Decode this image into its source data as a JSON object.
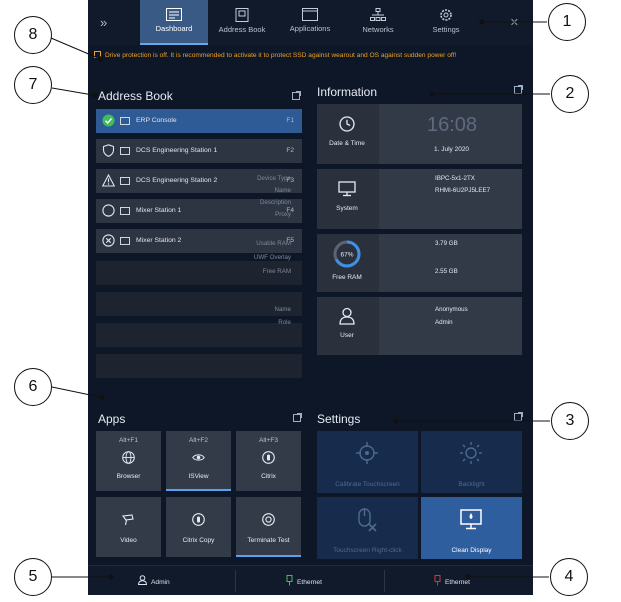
{
  "nav": {
    "tabs": [
      {
        "label": "Dashboard",
        "icon": "dashboard-icon",
        "active": true
      },
      {
        "label": "Address Book",
        "icon": "address-book-icon",
        "active": false
      },
      {
        "label": "Applications",
        "icon": "applications-icon",
        "active": false
      },
      {
        "label": "Networks",
        "icon": "networks-icon",
        "active": false
      },
      {
        "label": "Settings",
        "icon": "gear-icon",
        "active": false
      }
    ],
    "expand_glyph": "»",
    "close_glyph": "✕"
  },
  "warning": {
    "text": "Drive protection is off. It is recommended to activate it to protect SSD against wearout and OS against sudden power off!"
  },
  "address_book": {
    "title": "Address Book",
    "entries": [
      {
        "label": "ERP Console",
        "key": "F1",
        "status": "check-circle-icon",
        "selected": true
      },
      {
        "label": "DCS Engineering Station 1",
        "key": "F2",
        "status": "shield-icon",
        "selected": false
      },
      {
        "label": "DCS Engineering Station 2",
        "key": "F3",
        "status": "warning-triangle-icon",
        "selected": false
      },
      {
        "label": "Mixer Station 1",
        "key": "F4",
        "status": "empty-circle-icon",
        "selected": false
      },
      {
        "label": "Mixer Station 2",
        "key": "F5",
        "status": "x-circle-icon",
        "selected": false
      }
    ]
  },
  "information": {
    "title": "Information",
    "date_time": {
      "label": "Date & Time",
      "time": "16:08",
      "date": "1. July 2020"
    },
    "system": {
      "label": "System",
      "fields": [
        {
          "k": "Device Type",
          "v": "IBPC-5x1-2TX"
        },
        {
          "k": "Name",
          "v": "RHMI-6U2PJ5LEE7"
        },
        {
          "k": "Description",
          "v": ""
        },
        {
          "k": "Proxy",
          "v": ""
        }
      ]
    },
    "ram": {
      "label": "Free RAM",
      "percent_text": "67%",
      "percent": 67,
      "fields": [
        {
          "k": "Usable RAM",
          "v": "3.79 GB"
        },
        {
          "k": "UWF Overlay",
          "v": ""
        },
        {
          "k": "Free RAM",
          "v": "2.55 GB"
        }
      ]
    },
    "user": {
      "label": "User",
      "fields": [
        {
          "k": "Name",
          "v": "Anonymous"
        },
        {
          "k": "Role",
          "v": "Admin"
        }
      ]
    }
  },
  "apps": {
    "title": "Apps",
    "tiles": [
      {
        "hotkey": "Alt+F1",
        "label": "Browser",
        "icon": "globe-icon"
      },
      {
        "hotkey": "Alt+F2",
        "label": "ISView",
        "icon": "eye-icon"
      },
      {
        "hotkey": "Alt+F3",
        "label": "Citrix",
        "icon": "citrix-icon"
      },
      {
        "hotkey": "",
        "label": "Video",
        "icon": "camera-icon"
      },
      {
        "hotkey": "",
        "label": "Citrix Copy",
        "icon": "citrix-copy-icon"
      },
      {
        "hotkey": "",
        "label": "Terminate Test",
        "icon": "terminate-icon"
      }
    ]
  },
  "settings": {
    "title": "Settings",
    "tiles": [
      {
        "label": "Calibrate Touchscreen",
        "icon": "crosshair-icon"
      },
      {
        "label": "Backlight",
        "icon": "sun-icon"
      },
      {
        "label": "Touchscreen Right-click",
        "icon": "mouse-x-icon"
      },
      {
        "label": "Clean Display",
        "icon": "clean-display-icon"
      }
    ]
  },
  "bottom_bar": {
    "user": "Admin",
    "net1": "Ethernet",
    "net2": "Ethernet"
  },
  "callouts": [
    "1",
    "2",
    "3",
    "4",
    "5",
    "6",
    "7",
    "8"
  ],
  "colors": {
    "accent": "#2e5a95",
    "warning": "#f0a024",
    "background": "#0d1727",
    "net_ok": "#3fbf5a",
    "net_bad": "#e0303a"
  }
}
